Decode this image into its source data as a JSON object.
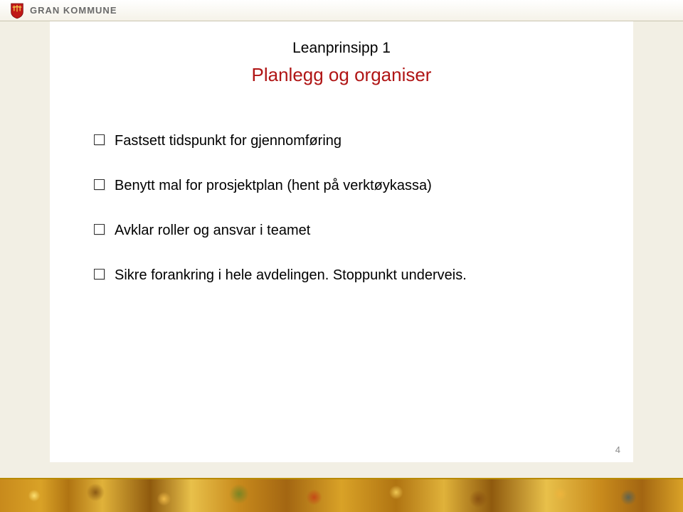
{
  "header": {
    "brand": "GRAN KOMMUNE"
  },
  "slide": {
    "overline": "Leanprinsipp 1",
    "title": "Planlegg og organiser",
    "bullets": [
      "Fastsett tidspunkt for gjennomføring",
      "Benytt mal for prosjektplan (hent på verktøykassa)",
      "Avklar roller og ansvar i teamet",
      "Sikre forankring i hele avdelingen. Stoppunkt underveis."
    ],
    "page_number": "4"
  }
}
